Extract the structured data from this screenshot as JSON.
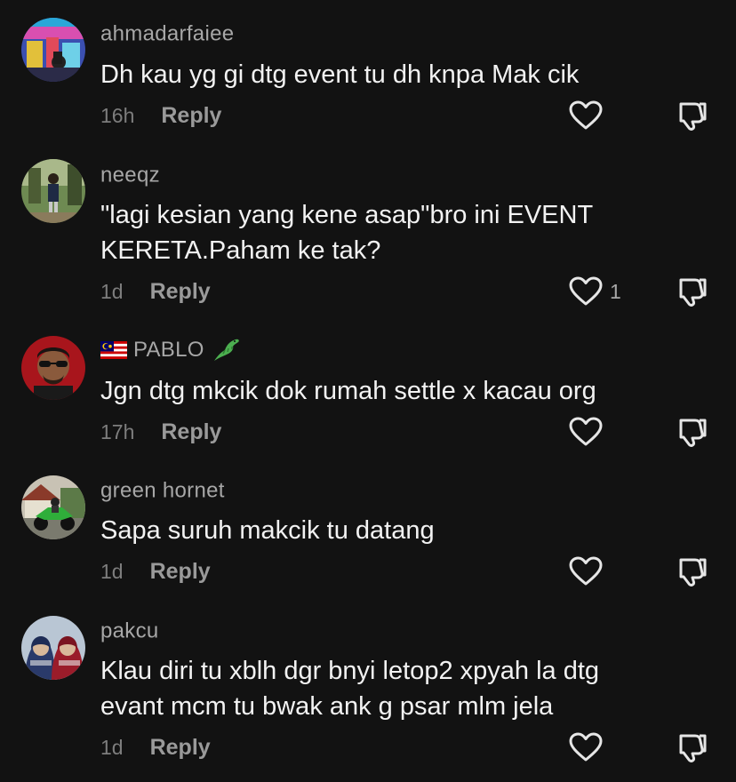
{
  "comments": [
    {
      "username": "ahmadarfaiee",
      "text": "Dh kau yg gi dtg event tu dh knpa Mak cik",
      "time": "16h",
      "reply": "Reply",
      "likes": ""
    },
    {
      "username": "neeqz",
      "text": "\"lagi kesian yang kene asap\"bro ini EVENT KERETA.Paham ke tak?",
      "time": "1d",
      "reply": "Reply",
      "likes": "1"
    },
    {
      "username": "PABLO",
      "text": "Jgn dtg mkcik dok rumah settle x kacau org",
      "time": "17h",
      "reply": "Reply",
      "likes": ""
    },
    {
      "username": "green hornet",
      "text": "Sapa suruh makcik tu datang",
      "time": "1d",
      "reply": "Reply",
      "likes": ""
    },
    {
      "username": "pakcu",
      "text": "Klau diri tu xblh dgr bnyi letop2 xpyah la dtg evant mcm tu bwak ank g psar mlm jela",
      "time": "1d",
      "reply": "Reply",
      "likes": ""
    }
  ],
  "colors": {
    "background": "#121212",
    "username": "#a7a7a7",
    "text": "#f2f2f2",
    "meta": "#7d7d7d",
    "icon": "#e6e6e6"
  },
  "icons": {
    "like": "heart-outline-icon",
    "dislike": "thumbs-down-icon",
    "flag": "malaysia-flag-icon",
    "emoji": "crocodile-icon"
  }
}
